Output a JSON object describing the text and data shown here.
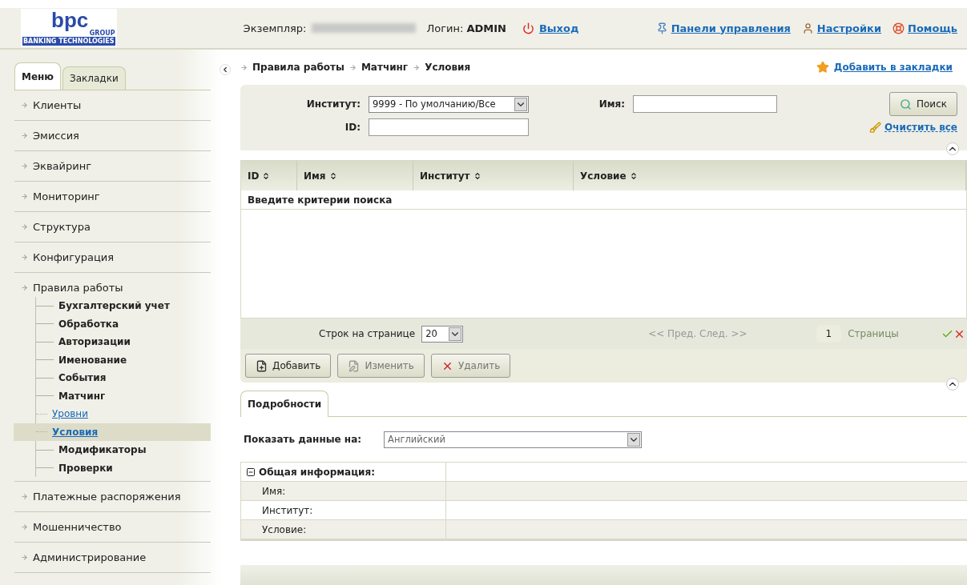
{
  "header": {
    "logo": {
      "name": "bpc",
      "group": "GROUP",
      "tagline": "BANKING TECHNOLOGIES"
    },
    "instance_label": "Экземпляр:",
    "login_label": "Логин:",
    "login_value": "ADMIN",
    "logout": "Выход",
    "links": [
      {
        "kind": "pin",
        "label": "Панели управления"
      },
      {
        "kind": "user",
        "label": "Настройки"
      },
      {
        "kind": "help",
        "label": "Помощь"
      }
    ]
  },
  "sidebar": {
    "tabs": [
      {
        "label": "Меню",
        "selected": true
      },
      {
        "label": "Закладки",
        "selected": false
      }
    ],
    "items": [
      {
        "label": "Клиенты",
        "selected": false
      },
      {
        "label": "Эмиссия",
        "selected": false
      },
      {
        "label": "Эквайринг",
        "selected": false
      },
      {
        "label": "Мониторинг",
        "selected": false
      },
      {
        "label": "Структура",
        "selected": false
      },
      {
        "label": "Конфигурация",
        "selected": false
      },
      {
        "label": "Правила работы",
        "selected": false,
        "children": [
          {
            "label": "Бухгалтерский учет",
            "selected": false
          },
          {
            "label": "Обработка",
            "selected": false
          },
          {
            "label": "Авторизации",
            "selected": false
          },
          {
            "label": "Именование",
            "selected": false
          },
          {
            "label": "События",
            "selected": false
          },
          {
            "label": "Матчинг",
            "selected": false,
            "children": [
              {
                "label": "Уровни",
                "selected": false
              },
              {
                "label": "Условия",
                "selected": true
              }
            ]
          },
          {
            "label": "Модификаторы",
            "selected": false
          },
          {
            "label": "Проверки",
            "selected": false
          }
        ]
      },
      {
        "label": "Платежные распоряжения",
        "selected": false
      },
      {
        "label": "Мошенничество",
        "selected": false
      },
      {
        "label": "Администрирование",
        "selected": false
      }
    ]
  },
  "breadcrumb": [
    "Правила работы",
    "Матчинг",
    "Условия"
  ],
  "bookmark": "Добавить в закладки",
  "search": {
    "institute_label": "Институт:",
    "institute_value": "9999 - По умолчанию/Все",
    "id_label": "ID:",
    "name_label": "Имя:",
    "search_button": "Поиск",
    "clear": "Очистить все"
  },
  "table": {
    "columns": [
      "ID",
      "Имя",
      "Институт",
      "Условие"
    ],
    "empty_message": "Введите критерии поиска"
  },
  "pager": {
    "rows_label": "Строк на странице",
    "rows_value": "20",
    "nav": "<< Пред. След. >>",
    "page": "1",
    "pages_label": "Страницы"
  },
  "toolbar": [
    {
      "kind": "add",
      "label": "Добавить",
      "disabled": false
    },
    {
      "kind": "edit",
      "label": "Изменить",
      "disabled": true
    },
    {
      "kind": "delete",
      "label": "Удалить",
      "disabled": true
    }
  ],
  "details": {
    "tab": {
      "label": "Подробности",
      "selected": true
    },
    "language_label": "Показать данные на:",
    "language_value": "Английский",
    "section": {
      "title": "Общая информация:",
      "expanded": true
    },
    "fields": [
      "Имя:",
      "Институт:",
      "Условие:"
    ]
  }
}
